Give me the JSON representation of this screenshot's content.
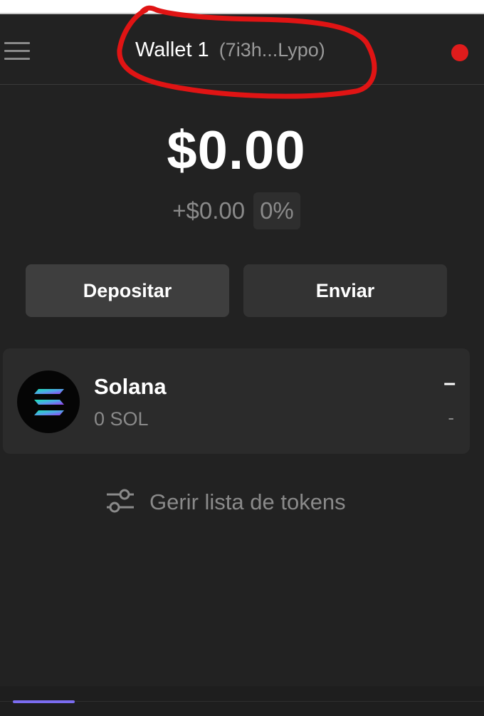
{
  "header": {
    "wallet_name": "Wallet 1",
    "wallet_address": "(7i3h...Lypo)",
    "menu_icon": "hamburger-menu-icon",
    "status_color": "#e01c1c"
  },
  "balance": {
    "total": "$0.00",
    "change_amount": "+$0.00",
    "change_percent": "0%"
  },
  "actions": {
    "deposit_label": "Depositar",
    "send_label": "Enviar"
  },
  "tokens": [
    {
      "name": "Solana",
      "balance": "0 SOL",
      "value": "–",
      "change": "-",
      "icon": "solana-logo"
    }
  ],
  "manage": {
    "label": "Gerir lista de tokens",
    "icon": "sliders-icon"
  },
  "colors": {
    "background": "#222222",
    "annotation": "#e01414",
    "accent": "#7b6cf0"
  }
}
